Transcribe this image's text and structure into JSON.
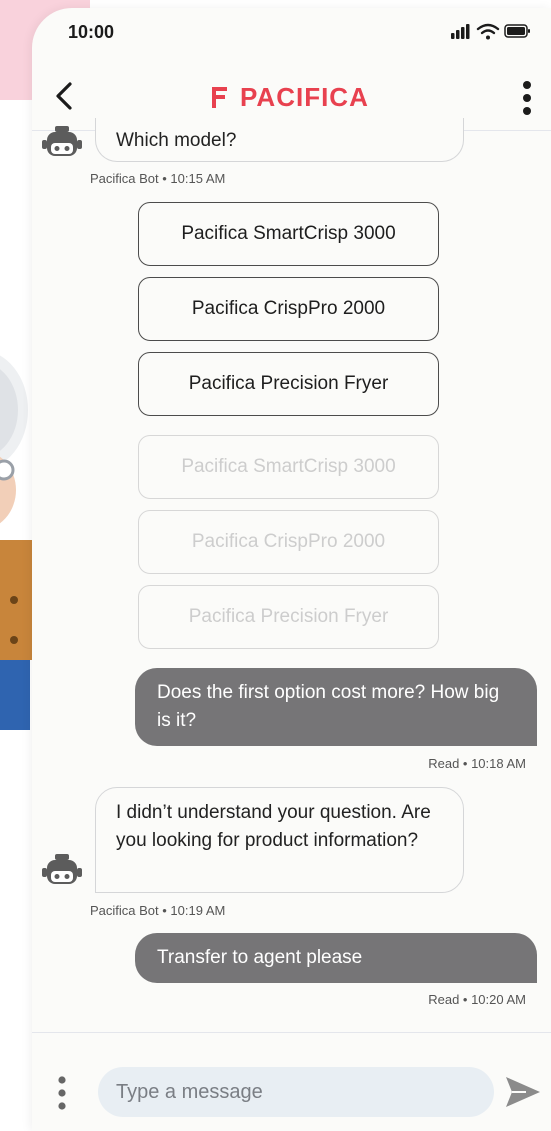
{
  "status_bar": {
    "time": "10:00"
  },
  "header": {
    "brand": "PACIFICA"
  },
  "messages": {
    "m1": {
      "text": "Which model?",
      "meta": "Pacifica Bot • 10:15 AM"
    },
    "m2": {
      "text": "Does the first option cost more? How big is it?",
      "meta": "Read • 10:18 AM"
    },
    "m3": {
      "text": "I didn’t understand your question. Are you looking for product information?",
      "meta": "Pacifica Bot • 10:19 AM"
    },
    "m4": {
      "text": "Transfer to agent please",
      "meta": "Read • 10:20 AM"
    }
  },
  "options_active": [
    "Pacifica SmartCrisp 3000",
    "Pacifica CrispPro 2000",
    "Pacifica Precision Fryer"
  ],
  "options_disabled": [
    "Pacifica SmartCrisp 3000",
    "Pacifica CrispPro 2000",
    "Pacifica Precision Fryer"
  ],
  "composer": {
    "placeholder": "Type a message"
  },
  "colors": {
    "brand": "#e8414f",
    "user_bubble": "#767577",
    "composer_field": "#e8eef3",
    "accent_pink": "#f9d2dc"
  },
  "icons": [
    "back-chevron-icon",
    "more-vertical-icon",
    "bot-icon",
    "send-icon",
    "menu-dots-icon",
    "signal-icon",
    "wifi-icon",
    "battery-icon"
  ]
}
